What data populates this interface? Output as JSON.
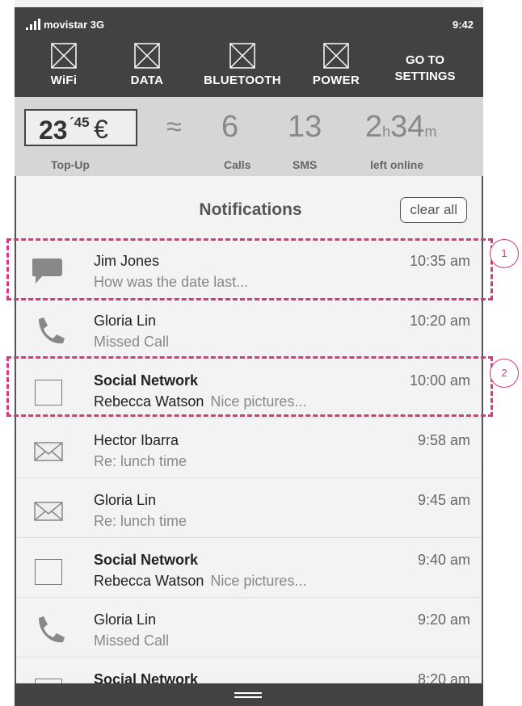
{
  "status": {
    "carrier": "movistar 3G",
    "time": "9:42"
  },
  "toggles": [
    {
      "name": "wifi",
      "label": "WiFi"
    },
    {
      "name": "data",
      "label": "DATA"
    },
    {
      "name": "bluetooth",
      "label": "BLUETOOTH"
    },
    {
      "name": "power",
      "label": "POWER"
    }
  ],
  "goto_settings": {
    "line1": "GO TO",
    "line2": "SETTINGS"
  },
  "stats": {
    "topup": {
      "amount": "23",
      "decimals": "´45",
      "currency": "€",
      "label": "Top-Up"
    },
    "approx_symbol": "≈",
    "calls": {
      "value": "6",
      "label": "Calls"
    },
    "sms": {
      "value": "13",
      "label": "SMS"
    },
    "online": {
      "hours": "2",
      "hours_unit": "h",
      "minutes": "34",
      "minutes_unit": "m",
      "label": "left online"
    }
  },
  "notifications": {
    "title": "Notifications",
    "clear_label": "clear all",
    "items": [
      {
        "icon": "chat-bubble-icon",
        "title": "Jim Jones",
        "bold": false,
        "sender": "",
        "preview": "How was the date last...",
        "time": "10:35 am"
      },
      {
        "icon": "phone-icon",
        "title": "Gloria Lin",
        "bold": false,
        "sender": "",
        "preview": "Missed Call",
        "time": "10:20 am"
      },
      {
        "icon": "image-placeholder-icon",
        "title": "Social Network",
        "bold": true,
        "sender": "Rebecca Watson",
        "preview": "Nice pictures...",
        "time": "10:00 am"
      },
      {
        "icon": "envelope-icon",
        "title": "Hector Ibarra",
        "bold": false,
        "sender": "",
        "preview": "Re: lunch time",
        "time": "9:58 am"
      },
      {
        "icon": "envelope-icon",
        "title": "Gloria Lin",
        "bold": false,
        "sender": "",
        "preview": "Re: lunch time",
        "time": "9:45 am"
      },
      {
        "icon": "image-placeholder-icon",
        "title": "Social Network",
        "bold": true,
        "sender": "Rebecca Watson",
        "preview": "Nice pictures...",
        "time": "9:40 am"
      },
      {
        "icon": "phone-icon",
        "title": "Gloria Lin",
        "bold": false,
        "sender": "",
        "preview": "Missed Call",
        "time": "9:20 am"
      },
      {
        "icon": "image-placeholder-icon",
        "title": "Social Network",
        "bold": true,
        "sender": "",
        "preview": "",
        "time": "8:20 am"
      }
    ]
  },
  "annotations": [
    {
      "number": "1"
    },
    {
      "number": "2"
    }
  ],
  "colors": {
    "annotation": "#d63a7b",
    "bar": "#424242"
  }
}
